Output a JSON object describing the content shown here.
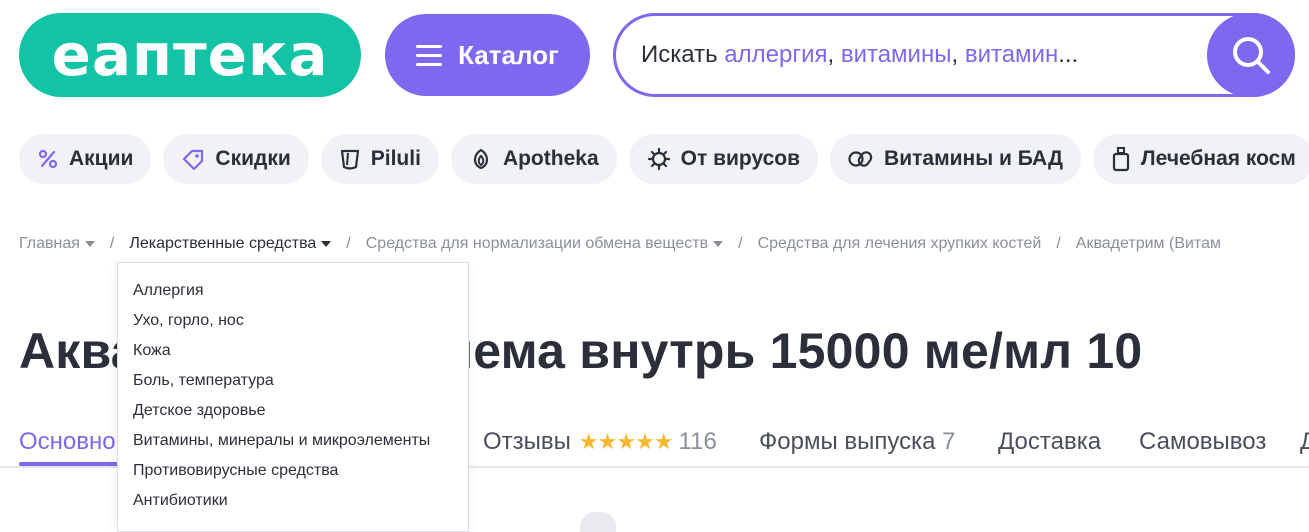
{
  "header": {
    "logo_text": "еаптека",
    "catalog_label": "Каталог",
    "search": {
      "prefix": "Искать ",
      "hint1": "аллергия",
      "comma1": ", ",
      "hint2": "витамины",
      "comma2": ", ",
      "hint3": "витамин",
      "ellipsis": "..."
    }
  },
  "chips": [
    {
      "label": "Акции",
      "icon": "percent-icon"
    },
    {
      "label": "Скидки",
      "icon": "tag-icon"
    },
    {
      "label": "Piluli",
      "icon": "cup-icon"
    },
    {
      "label": "Apotheka",
      "icon": "leaf-icon"
    },
    {
      "label": "От вирусов",
      "icon": "virus-icon"
    },
    {
      "label": "Витамины и БАД",
      "icon": "pills-icon"
    },
    {
      "label": "Лечебная косм",
      "icon": "bottle-icon"
    }
  ],
  "breadcrumb": [
    {
      "label": "Главная"
    },
    {
      "label": "Лекарственные средства"
    },
    {
      "label": "Средства для нормализации обмена веществ"
    },
    {
      "label": "Средства для лечения хрупких костей"
    },
    {
      "label": "Аквадетрим (Витам"
    }
  ],
  "dropdown": {
    "items": [
      "Аллергия",
      "Ухо, горло, нос",
      "Кожа",
      "Боль, температура",
      "Детское здоровье",
      "Витамины, минералы и микроэлементы",
      "Противовирусные средства",
      "Антибиотики"
    ]
  },
  "product": {
    "title_visible_left": "Аква",
    "title_visible_right": "для приема внутрь 15000 ме/мл 10"
  },
  "tabs": {
    "main": "Основно",
    "reviews": "Отзывы",
    "stars": "★★★★★",
    "rating_value": 5,
    "reviews_count": "116",
    "forms": "Формы выпуска",
    "forms_count": "7",
    "delivery": "Доставка",
    "pickup": "Самовывоз",
    "more": "Д"
  },
  "colors": {
    "brand_green": "#12c3a6",
    "accent_purple": "#7d68ef",
    "star_yellow": "#f5b82e"
  }
}
